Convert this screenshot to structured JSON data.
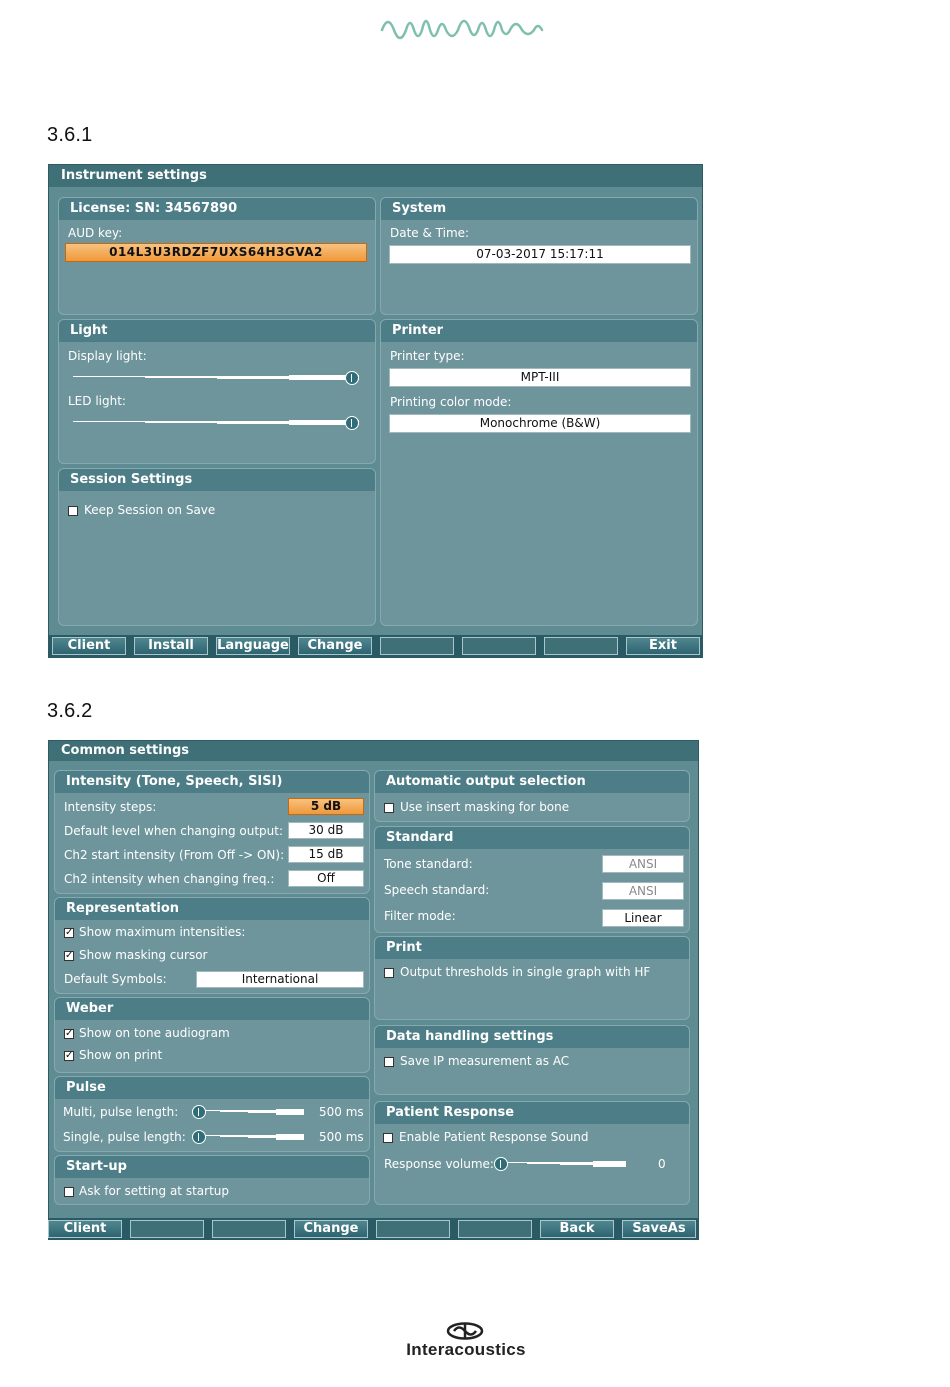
{
  "section1_number": "3.6.1",
  "section2_number": "3.6.2",
  "brand_name": "Interacoustics",
  "colors": {
    "accent_orange": "#f0983a",
    "panel": "#6f959c",
    "header": "#3f6f77",
    "logo_wave": "#7fbfae"
  },
  "instrument": {
    "title": "Instrument settings",
    "license": {
      "header": "License: SN: 34567890",
      "aud_key_label": "AUD key:",
      "aud_key_value": "014L3U3RDZF7UXS64H3GVA2"
    },
    "system": {
      "header": "System",
      "date_label": "Date & Time:",
      "date_value": "07-03-2017 15:17:11"
    },
    "light": {
      "header": "Light",
      "display_label": "Display light:",
      "display_level": 1.0,
      "led_label": "LED light:",
      "led_level": 1.0
    },
    "printer": {
      "header": "Printer",
      "type_label": "Printer type:",
      "type_value": "MPT-III",
      "color_label": "Printing color mode:",
      "color_value": "Monochrome (B&W)"
    },
    "session": {
      "header": "Session Settings",
      "keep_label": "Keep Session on Save",
      "keep_checked": false
    },
    "buttons": [
      "Client",
      "Install",
      "Language",
      "Change",
      "",
      "",
      "",
      "Exit"
    ]
  },
  "common": {
    "title": "Common settings",
    "intensity": {
      "header": "Intensity (Tone, Speech, SISI)",
      "rows": [
        {
          "label": "Intensity steps:",
          "value": "5 dB"
        },
        {
          "label": "Default level when changing output:",
          "value": "30 dB"
        },
        {
          "label": "Ch2 start intensity (From Off -> ON):",
          "value": "15 dB"
        },
        {
          "label": "Ch2 intensity when changing freq.:",
          "value": "Off"
        }
      ]
    },
    "representation": {
      "header": "Representation",
      "max_label": "Show maximum intensities:",
      "max_checked": true,
      "cursor_label": "Show masking cursor",
      "cursor_checked": true,
      "symbols_label": "Default Symbols:",
      "symbols_value": "International"
    },
    "weber": {
      "header": "Weber",
      "tone_label": "Show on tone audiogram",
      "tone_checked": true,
      "print_label": "Show on print",
      "print_checked": true
    },
    "pulse": {
      "header": "Pulse",
      "multi_label": "Multi, pulse length:",
      "multi_value": "500 ms",
      "multi_level": 0.0,
      "single_label": "Single, pulse length:",
      "single_value": "500 ms",
      "single_level": 0.0
    },
    "startup": {
      "header": "Start-up",
      "ask_label": "Ask for setting at startup",
      "ask_checked": false
    },
    "auto_output": {
      "header": "Automatic output selection",
      "insert_label": "Use insert masking for bone",
      "insert_checked": false
    },
    "standard": {
      "header": "Standard",
      "tone_label": "Tone standard:",
      "tone_value": "ANSI",
      "speech_label": "Speech standard:",
      "speech_value": "ANSI",
      "filter_label": "Filter mode:",
      "filter_value": "Linear"
    },
    "print": {
      "header": "Print",
      "output_label": "Output thresholds in single graph with HF",
      "output_checked": false
    },
    "data_handling": {
      "header": "Data handling settings",
      "ip_label": "Save IP measurement as AC",
      "ip_checked": false
    },
    "patient_response": {
      "header": "Patient Response",
      "enable_label": "Enable Patient Response Sound",
      "enable_checked": false,
      "volume_label": "Response volume:",
      "volume_value": "0",
      "volume_level": 0.0
    },
    "buttons": [
      "Client",
      "",
      "",
      "Change",
      "",
      "",
      "Back",
      "SaveAs"
    ]
  }
}
